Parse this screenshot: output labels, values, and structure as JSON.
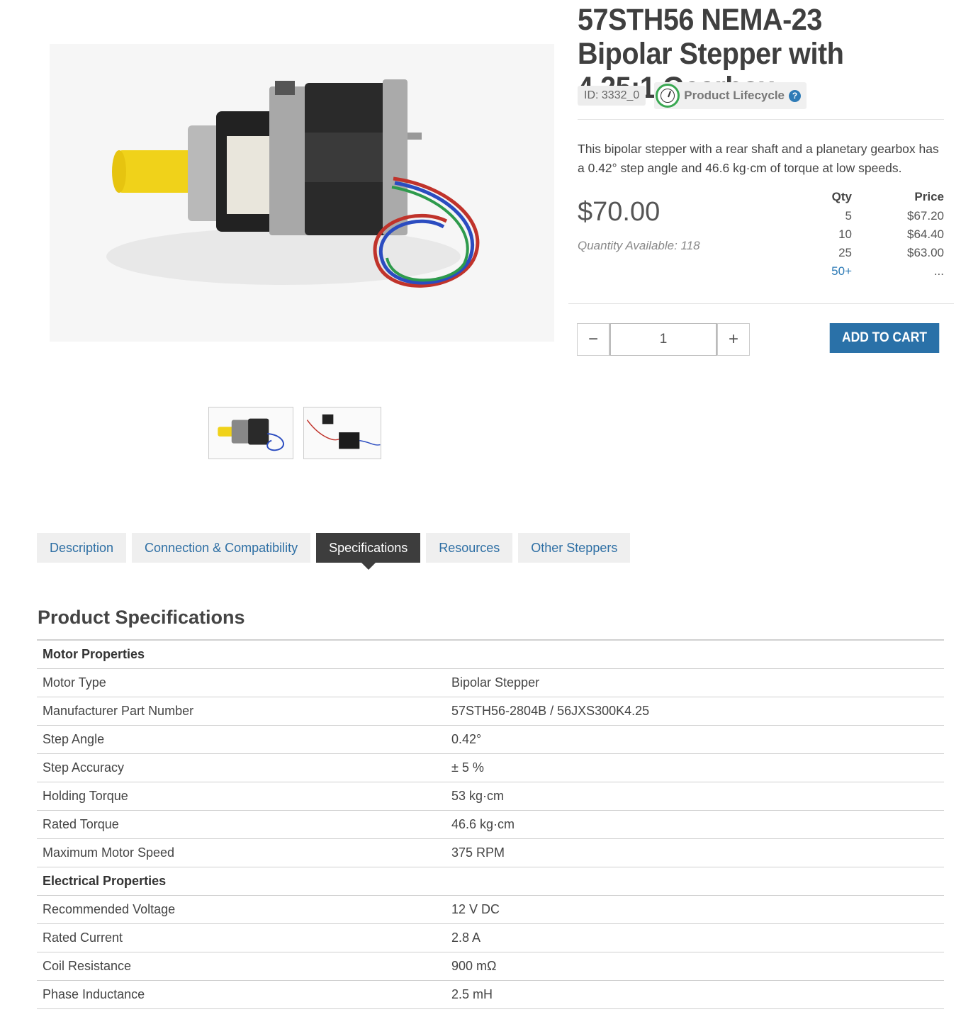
{
  "product": {
    "title": "57STH56 NEMA-23 Bipolar Stepper with 4.25:1 Gearbox",
    "id_label": "ID: 3332_0",
    "lifecycle_label": "Product Lifecycle",
    "help_glyph": "?",
    "description": "This bipolar stepper with a rear shaft and a planetary gearbox has a 0.42° step angle and 46.6 kg·cm of torque at low speeds.",
    "price": "$70.00",
    "quantity_available": "Quantity Available: 118"
  },
  "price_breaks": {
    "qty_header": "Qty",
    "price_header": "Price",
    "rows": [
      {
        "qty": "5",
        "price": "$67.20"
      },
      {
        "qty": "10",
        "price": "$64.40"
      },
      {
        "qty": "25",
        "price": "$63.00"
      },
      {
        "qty": "50+",
        "price": "..."
      }
    ]
  },
  "cart": {
    "minus": "−",
    "plus": "+",
    "quantity": "1",
    "add_label": "ADD TO CART",
    "button_color": "#2a71a8"
  },
  "tabs": [
    {
      "label": "Description",
      "active": false
    },
    {
      "label": "Connection & Compatibility",
      "active": false
    },
    {
      "label": "Specifications",
      "active": true
    },
    {
      "label": "Resources",
      "active": false
    },
    {
      "label": "Other Steppers",
      "active": false
    }
  ],
  "specs": {
    "heading": "Product Specifications",
    "rows": [
      {
        "section": "Motor Properties"
      },
      {
        "key": "Motor Type",
        "value": "Bipolar Stepper"
      },
      {
        "key": "Manufacturer Part Number",
        "value": "57STH56-2804B / 56JXS300K4.25"
      },
      {
        "key": "Step Angle",
        "value": "0.42°"
      },
      {
        "key": "Step Accuracy",
        "value": "± 5 %"
      },
      {
        "key": "Holding Torque",
        "value": "53 kg·cm"
      },
      {
        "key": "Rated Torque",
        "value": "46.6 kg·cm"
      },
      {
        "key": "Maximum Motor Speed",
        "value": "375 RPM"
      },
      {
        "section": "Electrical Properties"
      },
      {
        "key": "Recommended Voltage",
        "value": "12 V DC"
      },
      {
        "key": "Rated Current",
        "value": "2.8 A"
      },
      {
        "key": "Coil Resistance",
        "value": "900 mΩ"
      },
      {
        "key": "Phase Inductance",
        "value": "2.5 mH"
      }
    ]
  }
}
